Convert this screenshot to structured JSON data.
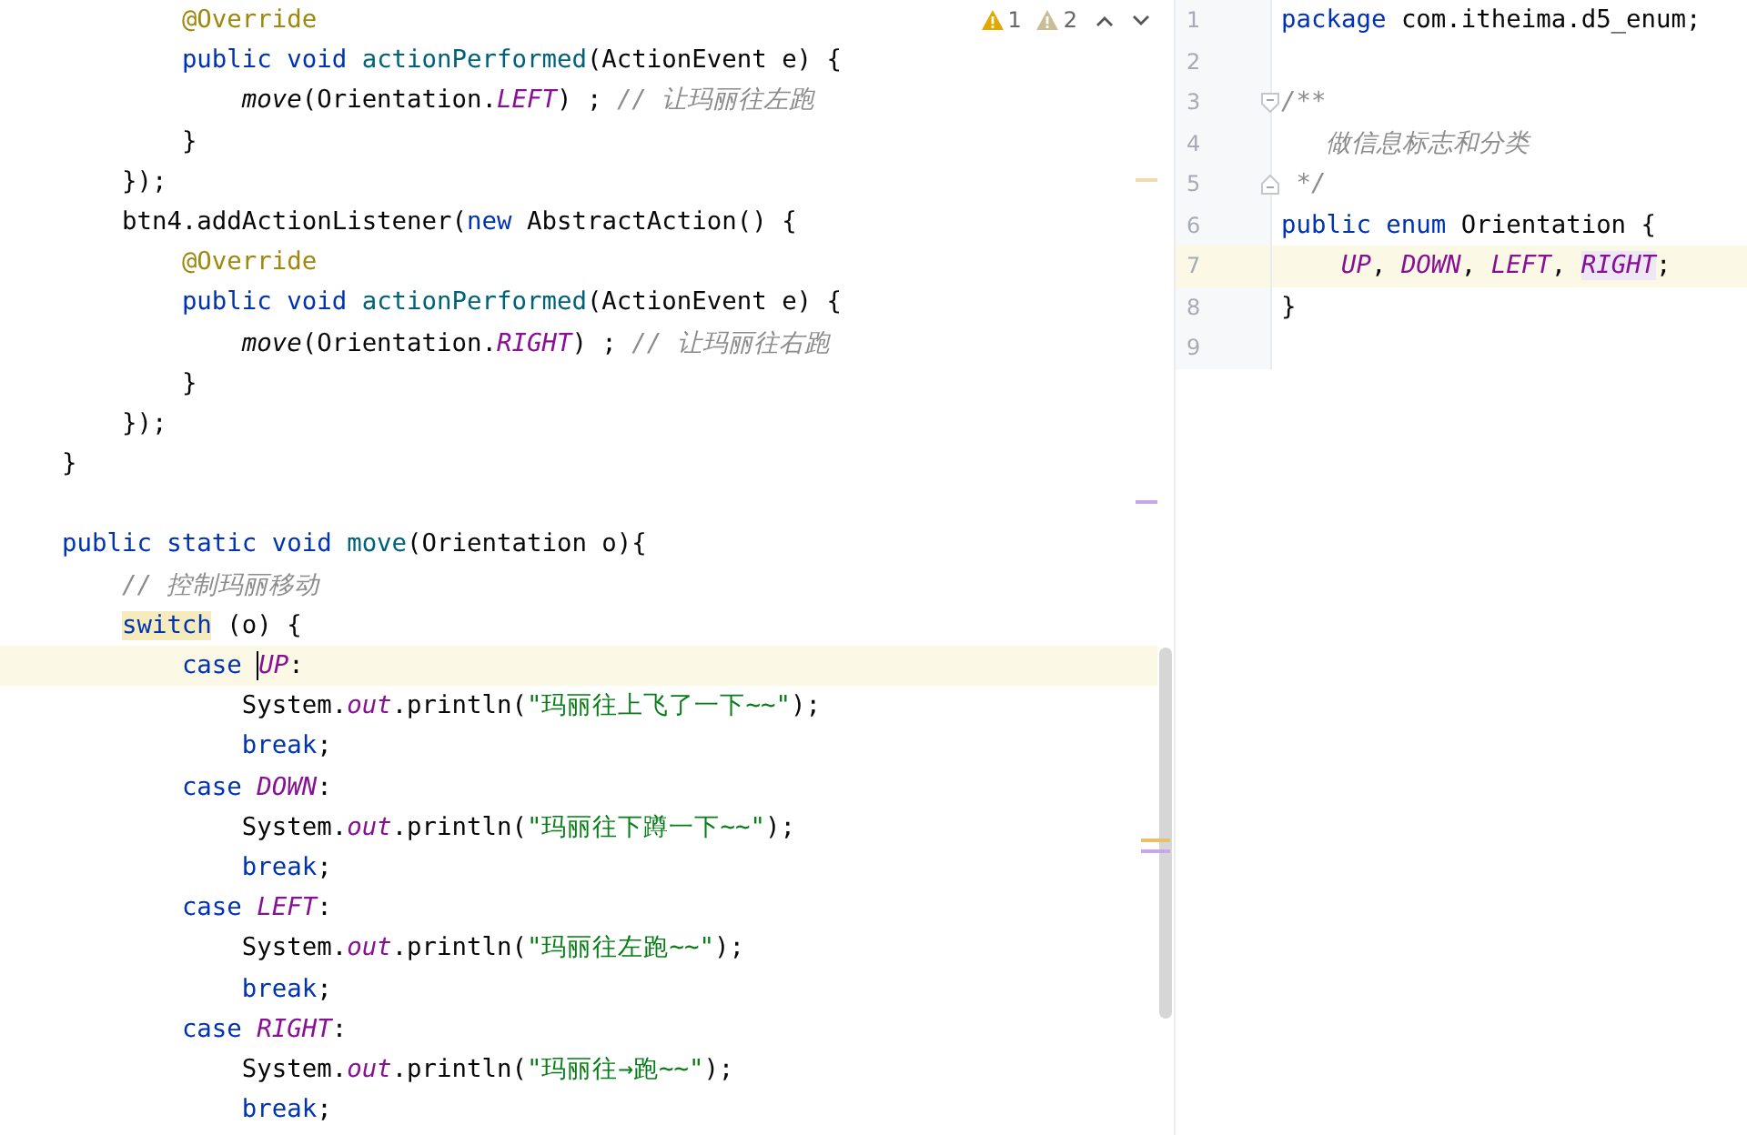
{
  "left_editor": {
    "inspections": [
      {
        "kind": "warning",
        "count": "1"
      },
      {
        "kind": "weak-warning",
        "count": "2"
      }
    ],
    "lines": [
      {
        "kind": "code",
        "tokens": [
          {
            "kind": "annotation",
            "t": "        @Override"
          }
        ]
      },
      {
        "kind": "code",
        "tokens": [
          {
            "kind": "keyword",
            "t": "        public void "
          },
          {
            "kind": "method",
            "t": "actionPerformed"
          },
          {
            "kind": "plain",
            "t": "(ActionEvent e) {"
          }
        ]
      },
      {
        "kind": "code",
        "tokens": [
          {
            "kind": "static-call",
            "t": "            move"
          },
          {
            "kind": "plain",
            "t": "(Orientation."
          },
          {
            "kind": "constant",
            "t": "LEFT"
          },
          {
            "kind": "plain",
            "t": ") ; "
          },
          {
            "kind": "comment",
            "t": "// 让玛丽往左跑"
          }
        ]
      },
      {
        "kind": "code",
        "tokens": [
          {
            "kind": "plain",
            "t": "        }"
          }
        ]
      },
      {
        "kind": "code",
        "tokens": [
          {
            "kind": "plain",
            "t": "    });"
          }
        ]
      },
      {
        "kind": "code",
        "tokens": [
          {
            "kind": "plain",
            "t": "    btn4.addActionListener("
          },
          {
            "kind": "keyword",
            "t": "new"
          },
          {
            "kind": "plain",
            "t": " AbstractAction() {"
          }
        ]
      },
      {
        "kind": "code",
        "tokens": [
          {
            "kind": "annotation",
            "t": "        @Override"
          }
        ]
      },
      {
        "kind": "code",
        "tokens": [
          {
            "kind": "keyword",
            "t": "        public void "
          },
          {
            "kind": "method",
            "t": "actionPerformed"
          },
          {
            "kind": "plain",
            "t": "(ActionEvent e) {"
          }
        ]
      },
      {
        "kind": "code",
        "tokens": [
          {
            "kind": "static-call",
            "t": "            move"
          },
          {
            "kind": "plain",
            "t": "(Orientation."
          },
          {
            "kind": "constant",
            "t": "RIGHT"
          },
          {
            "kind": "plain",
            "t": ") ; "
          },
          {
            "kind": "comment",
            "t": "// 让玛丽往右跑"
          }
        ]
      },
      {
        "kind": "code",
        "tokens": [
          {
            "kind": "plain",
            "t": "        }"
          }
        ]
      },
      {
        "kind": "code",
        "tokens": [
          {
            "kind": "plain",
            "t": "    });"
          }
        ]
      },
      {
        "kind": "code",
        "tokens": [
          {
            "kind": "plain",
            "t": "}"
          }
        ]
      },
      {
        "kind": "blank"
      },
      {
        "kind": "code",
        "tokens": [
          {
            "kind": "keyword",
            "t": "public static void "
          },
          {
            "kind": "method",
            "t": "move"
          },
          {
            "kind": "plain",
            "t": "(Orientation o){"
          }
        ]
      },
      {
        "kind": "code",
        "tokens": [
          {
            "kind": "comment",
            "t": "    // 控制玛丽移动"
          }
        ]
      },
      {
        "kind": "code",
        "tokens": [
          {
            "kind": "keyword-match",
            "t": "    switch"
          },
          {
            "kind": "plain",
            "t": " (o) {"
          }
        ]
      },
      {
        "kind": "current",
        "tokens": [
          {
            "kind": "keyword",
            "t": "        case "
          },
          {
            "kind": "constant-caret",
            "t": "UP"
          },
          {
            "kind": "plain",
            "t": ":"
          }
        ]
      },
      {
        "kind": "code",
        "tokens": [
          {
            "kind": "plain",
            "t": "            System."
          },
          {
            "kind": "constant",
            "t": "out"
          },
          {
            "kind": "plain",
            "t": ".println("
          },
          {
            "kind": "string",
            "t": "\"玛丽往上飞了一下~~\""
          },
          {
            "kind": "plain",
            "t": ");"
          }
        ]
      },
      {
        "kind": "code",
        "tokens": [
          {
            "kind": "keyword",
            "t": "            break"
          },
          {
            "kind": "plain",
            "t": ";"
          }
        ]
      },
      {
        "kind": "code",
        "tokens": [
          {
            "kind": "keyword",
            "t": "        case "
          },
          {
            "kind": "constant",
            "t": "DOWN"
          },
          {
            "kind": "plain",
            "t": ":"
          }
        ]
      },
      {
        "kind": "code",
        "tokens": [
          {
            "kind": "plain",
            "t": "            System."
          },
          {
            "kind": "constant",
            "t": "out"
          },
          {
            "kind": "plain",
            "t": ".println("
          },
          {
            "kind": "string",
            "t": "\"玛丽往下蹲一下~~\""
          },
          {
            "kind": "plain",
            "t": ");"
          }
        ]
      },
      {
        "kind": "code",
        "tokens": [
          {
            "kind": "keyword",
            "t": "            break"
          },
          {
            "kind": "plain",
            "t": ";"
          }
        ]
      },
      {
        "kind": "code",
        "tokens": [
          {
            "kind": "keyword",
            "t": "        case "
          },
          {
            "kind": "constant",
            "t": "LEFT"
          },
          {
            "kind": "plain",
            "t": ":"
          }
        ]
      },
      {
        "kind": "code",
        "tokens": [
          {
            "kind": "plain",
            "t": "            System."
          },
          {
            "kind": "constant",
            "t": "out"
          },
          {
            "kind": "plain",
            "t": ".println("
          },
          {
            "kind": "string",
            "t": "\"玛丽往左跑~~\""
          },
          {
            "kind": "plain",
            "t": ");"
          }
        ]
      },
      {
        "kind": "code",
        "tokens": [
          {
            "kind": "keyword",
            "t": "            break"
          },
          {
            "kind": "plain",
            "t": ";"
          }
        ]
      },
      {
        "kind": "code",
        "tokens": [
          {
            "kind": "keyword",
            "t": "        case "
          },
          {
            "kind": "constant",
            "t": "RIGHT"
          },
          {
            "kind": "plain",
            "t": ":"
          }
        ]
      },
      {
        "kind": "code",
        "tokens": [
          {
            "kind": "plain",
            "t": "            System."
          },
          {
            "kind": "constant",
            "t": "out"
          },
          {
            "kind": "plain",
            "t": ".println("
          },
          {
            "kind": "string",
            "t": "\"玛丽往→跑~~\""
          },
          {
            "kind": "plain",
            "t": ");"
          }
        ]
      },
      {
        "kind": "code",
        "tokens": [
          {
            "kind": "keyword",
            "t": "            break"
          },
          {
            "kind": "plain",
            "t": ";"
          }
        ]
      }
    ]
  },
  "right_editor": {
    "lines": [
      {
        "number": "1",
        "kind": "code",
        "fold_start": false,
        "fold_end": false,
        "tokens": [
          {
            "kind": "keyword",
            "t": "package"
          },
          {
            "kind": "plain",
            "t": " com.itheima.d5_enum;"
          }
        ]
      },
      {
        "number": "2",
        "kind": "blank",
        "fold_start": false,
        "fold_end": false
      },
      {
        "number": "3",
        "kind": "code",
        "fold_start": true,
        "fold_end": false,
        "tokens": [
          {
            "kind": "comment",
            "t": "/**"
          }
        ]
      },
      {
        "number": "4",
        "kind": "code",
        "fold_start": false,
        "fold_end": false,
        "tokens": [
          {
            "kind": "comment",
            "t": "   做信息标志和分类"
          }
        ]
      },
      {
        "number": "5",
        "kind": "code",
        "fold_start": false,
        "fold_end": true,
        "tokens": [
          {
            "kind": "comment",
            "t": " */"
          }
        ]
      },
      {
        "number": "6",
        "kind": "code",
        "fold_start": false,
        "fold_end": false,
        "tokens": [
          {
            "kind": "keyword",
            "t": "public enum"
          },
          {
            "kind": "plain",
            "t": " Orientation {"
          }
        ]
      },
      {
        "number": "7",
        "kind": "current",
        "fold_start": false,
        "fold_end": false,
        "tokens": [
          {
            "kind": "constant",
            "t": "    UP"
          },
          {
            "kind": "plain",
            "t": ", "
          },
          {
            "kind": "constant",
            "t": "DOWN"
          },
          {
            "kind": "plain",
            "t": ", "
          },
          {
            "kind": "constant",
            "t": "LEFT"
          },
          {
            "kind": "plain",
            "t": ", "
          },
          {
            "kind": "constant-match",
            "t": "RIGHT"
          },
          {
            "kind": "plain",
            "t": ";"
          }
        ]
      },
      {
        "number": "8",
        "kind": "code",
        "fold_start": false,
        "fold_end": false,
        "tokens": [
          {
            "kind": "plain",
            "t": "}"
          }
        ]
      },
      {
        "number": "9",
        "kind": "blank",
        "fold_start": false,
        "fold_end": false
      }
    ]
  }
}
